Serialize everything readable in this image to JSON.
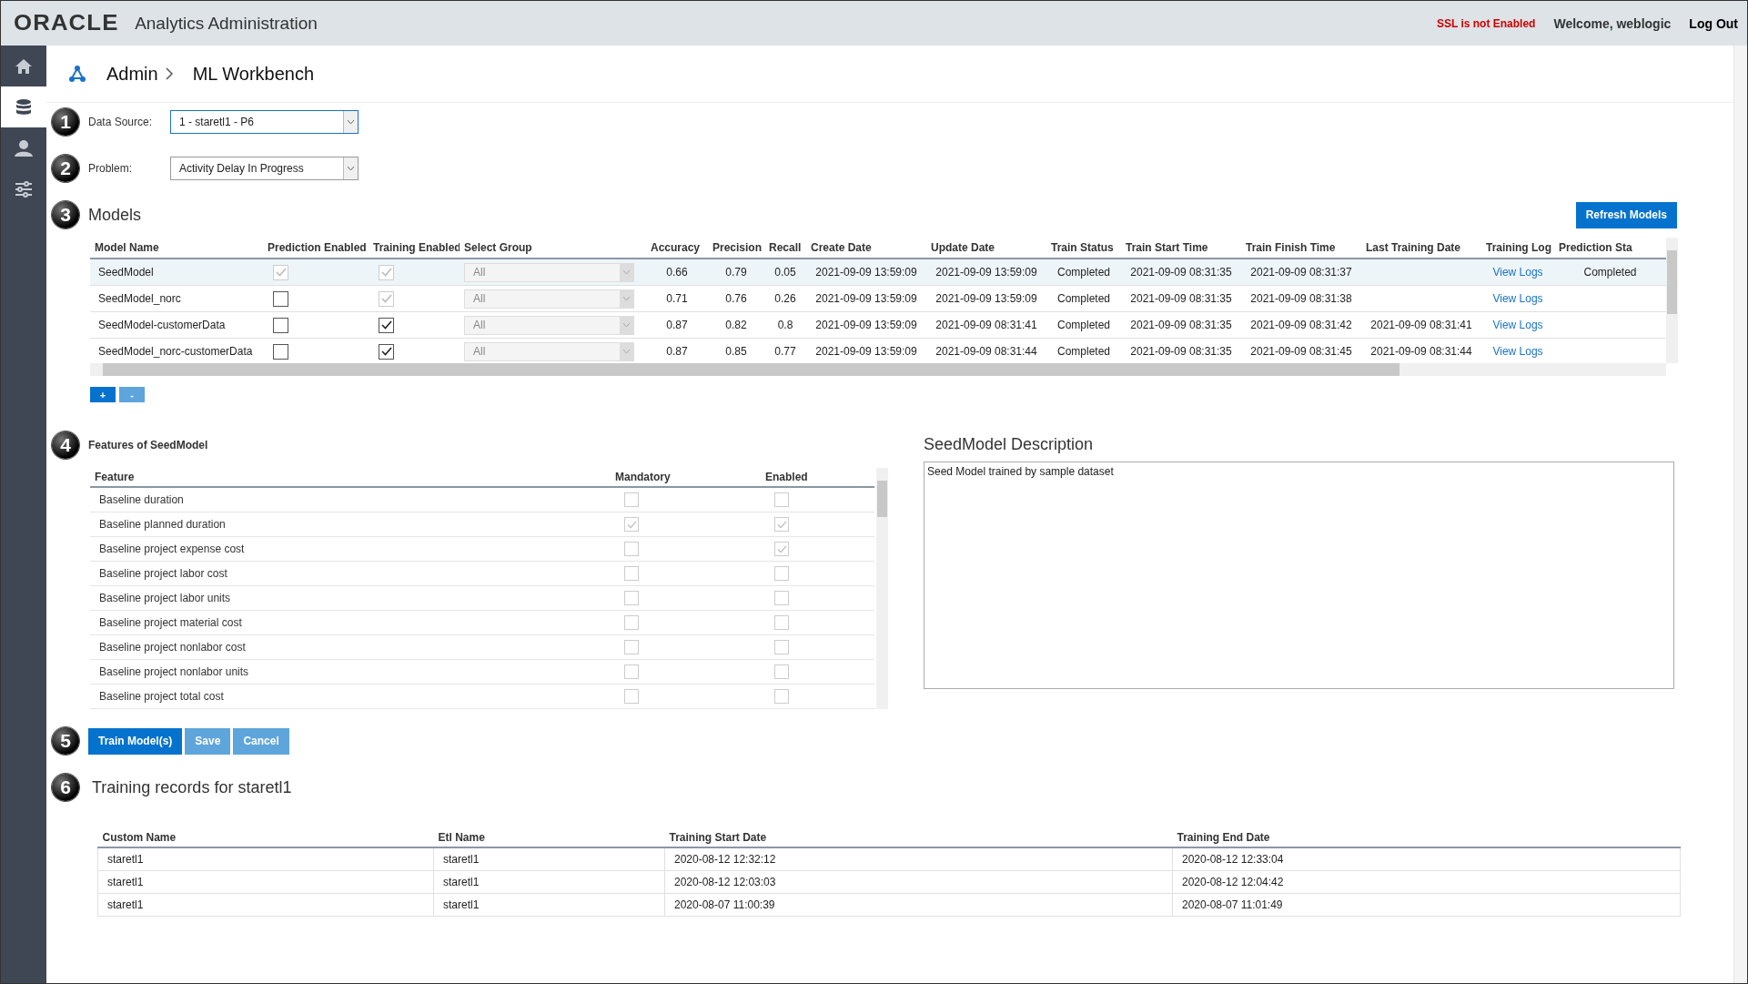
{
  "header": {
    "logo": "ORACLE",
    "title": "Analytics Administration",
    "ssl_warning": "SSL is not Enabled",
    "welcome": "Welcome, weblogic",
    "logout": "Log Out"
  },
  "sidebar": {
    "items": [
      {
        "kind": "home",
        "selected": false
      },
      {
        "kind": "database",
        "selected": true
      },
      {
        "kind": "user",
        "selected": false
      },
      {
        "kind": "sliders",
        "selected": false
      }
    ]
  },
  "breadcrumb": [
    "Admin",
    "ML Workbench"
  ],
  "data_source": {
    "step": "1",
    "label": "Data Source:",
    "value": "1 - staretl1 - P6",
    "focused": true
  },
  "problem": {
    "step": "2",
    "label": "Problem:",
    "value": "Activity Delay In Progress",
    "focused": false
  },
  "models": {
    "step": "3",
    "title": "Models",
    "refresh_button": "Refresh Models",
    "columns": [
      "Model Name",
      "Prediction Enabled",
      "Training Enabled",
      "Select Group",
      "Accuracy",
      "Precision",
      "Recall",
      "Create Date",
      "Update Date",
      "Train Status",
      "Train Start Time",
      "Train Finish Time",
      "Last Training Date",
      "Training Log",
      "Prediction Sta"
    ],
    "rows": [
      {
        "selected": true,
        "name": "SeedModel",
        "prediction_enabled": {
          "checked": true,
          "disabled": true
        },
        "training_enabled": {
          "checked": true,
          "disabled": true
        },
        "group": "All",
        "accuracy": "0.66",
        "precision": "0.79",
        "recall": "0.05",
        "create_date": "2021-09-09 13:59:09",
        "update_date": "2021-09-09 13:59:09",
        "train_status": "Completed",
        "train_start": "2021-09-09 08:31:35",
        "train_finish": "2021-09-09 08:31:37",
        "last_training": "",
        "log_link": "View Logs",
        "prediction_status": "Completed"
      },
      {
        "selected": false,
        "name": "SeedModel_norc",
        "prediction_enabled": {
          "checked": false,
          "disabled": false
        },
        "training_enabled": {
          "checked": true,
          "disabled": true
        },
        "group": "All",
        "accuracy": "0.71",
        "precision": "0.76",
        "recall": "0.26",
        "create_date": "2021-09-09 13:59:09",
        "update_date": "2021-09-09 13:59:09",
        "train_status": "Completed",
        "train_start": "2021-09-09 08:31:35",
        "train_finish": "2021-09-09 08:31:38",
        "last_training": "",
        "log_link": "View Logs",
        "prediction_status": ""
      },
      {
        "selected": false,
        "name": "SeedModel-customerData",
        "prediction_enabled": {
          "checked": false,
          "disabled": false
        },
        "training_enabled": {
          "checked": true,
          "disabled": false
        },
        "group": "All",
        "accuracy": "0.87",
        "precision": "0.82",
        "recall": "0.8",
        "create_date": "2021-09-09 13:59:09",
        "update_date": "2021-09-09 08:31:41",
        "train_status": "Completed",
        "train_start": "2021-09-09 08:31:35",
        "train_finish": "2021-09-09 08:31:42",
        "last_training": "2021-09-09 08:31:41",
        "log_link": "View Logs",
        "prediction_status": ""
      },
      {
        "selected": false,
        "name": "SeedModel_norc-customerData",
        "prediction_enabled": {
          "checked": false,
          "disabled": false
        },
        "training_enabled": {
          "checked": true,
          "disabled": false
        },
        "group": "All",
        "accuracy": "0.87",
        "precision": "0.85",
        "recall": "0.77",
        "create_date": "2021-09-09 13:59:09",
        "update_date": "2021-09-09 08:31:44",
        "train_status": "Completed",
        "train_start": "2021-09-09 08:31:35",
        "train_finish": "2021-09-09 08:31:45",
        "last_training": "2021-09-09 08:31:44",
        "log_link": "View Logs",
        "prediction_status": ""
      }
    ],
    "add_button": "+",
    "remove_button": "-"
  },
  "features": {
    "step": "4",
    "title": "Features of SeedModel",
    "columns": [
      "Feature",
      "Mandatory",
      "Enabled"
    ],
    "rows": [
      {
        "name": "Baseline duration",
        "mandatory": {
          "checked": false,
          "disabled": true
        },
        "enabled": {
          "checked": false,
          "disabled": true
        }
      },
      {
        "name": "Baseline planned duration",
        "mandatory": {
          "checked": true,
          "disabled": true
        },
        "enabled": {
          "checked": true,
          "disabled": true
        }
      },
      {
        "name": "Baseline project expense cost",
        "mandatory": {
          "checked": false,
          "disabled": true
        },
        "enabled": {
          "checked": true,
          "disabled": true
        }
      },
      {
        "name": "Baseline project labor cost",
        "mandatory": {
          "checked": false,
          "disabled": true
        },
        "enabled": {
          "checked": false,
          "disabled": true
        }
      },
      {
        "name": "Baseline project labor units",
        "mandatory": {
          "checked": false,
          "disabled": true
        },
        "enabled": {
          "checked": false,
          "disabled": true
        }
      },
      {
        "name": "Baseline project material cost",
        "mandatory": {
          "checked": false,
          "disabled": true
        },
        "enabled": {
          "checked": false,
          "disabled": true
        }
      },
      {
        "name": "Baseline project nonlabor cost",
        "mandatory": {
          "checked": false,
          "disabled": true
        },
        "enabled": {
          "checked": false,
          "disabled": true
        }
      },
      {
        "name": "Baseline project nonlabor units",
        "mandatory": {
          "checked": false,
          "disabled": true
        },
        "enabled": {
          "checked": false,
          "disabled": true
        }
      },
      {
        "name": "Baseline project total cost",
        "mandatory": {
          "checked": false,
          "disabled": true
        },
        "enabled": {
          "checked": false,
          "disabled": true
        }
      }
    ]
  },
  "description": {
    "title": "SeedModel Description",
    "value": "Seed Model trained by sample dataset"
  },
  "actions": {
    "step": "5",
    "buttons": [
      {
        "label": "Train Model(s)",
        "kind": "primary"
      },
      {
        "label": "Save",
        "kind": "secondary"
      },
      {
        "label": "Cancel",
        "kind": "secondary"
      }
    ]
  },
  "training_records": {
    "step": "6",
    "title": "Training records for staretl1",
    "columns": [
      "Custom Name",
      "Etl Name",
      "Training Start Date",
      "Training End Date"
    ],
    "rows": [
      [
        "staretl1",
        "staretl1",
        "2020-08-12 12:32:12",
        "2020-08-12 12:33:04"
      ],
      [
        "staretl1",
        "staretl1",
        "2020-08-12 12:03:03",
        "2020-08-12 12:04:42"
      ],
      [
        "staretl1",
        "staretl1",
        "2020-08-07 11:00:39",
        "2020-08-07 11:01:49"
      ]
    ]
  }
}
